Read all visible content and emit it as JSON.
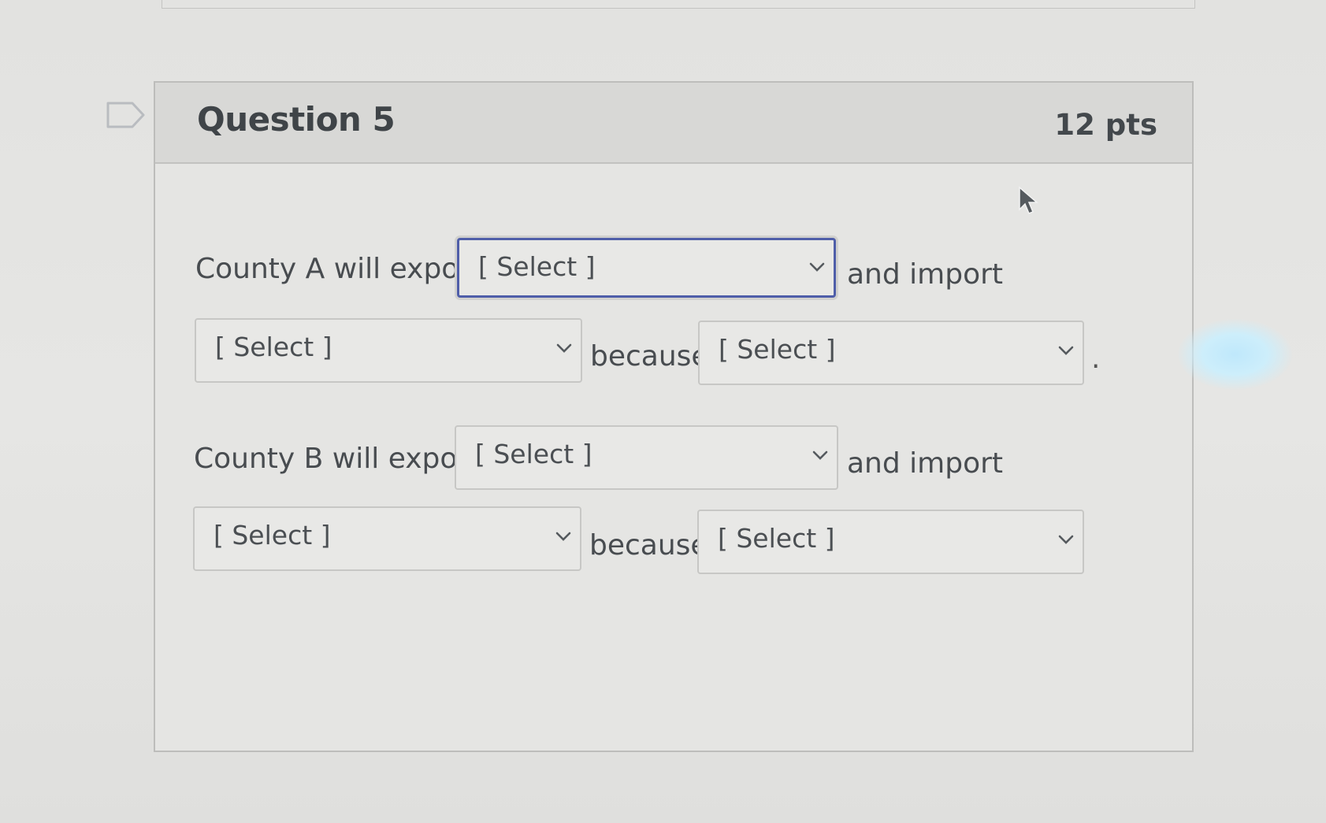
{
  "question": {
    "title": "Question 5",
    "points": "12 pts"
  },
  "county_a": {
    "lead_text": "County A will export",
    "export_select": "[ Select ]",
    "import_text": "and import",
    "import_select": "[ Select ]",
    "because_text": "because",
    "because_select": "[ Select ]",
    "end_punct": "."
  },
  "county_b": {
    "lead_text": "County B will export",
    "export_select": "[ Select ]",
    "import_text": "and import",
    "import_select": "[ Select ]",
    "because_text": "because",
    "because_select": "[ Select ]"
  },
  "icons": {
    "flag": "flag-icon",
    "dropdown": "chevron-down-icon",
    "cursor": "mouse-pointer-icon"
  },
  "colors": {
    "focus_border": "#4f5ea9",
    "header_bg": "#d8d8d6",
    "text": "#484c50"
  }
}
